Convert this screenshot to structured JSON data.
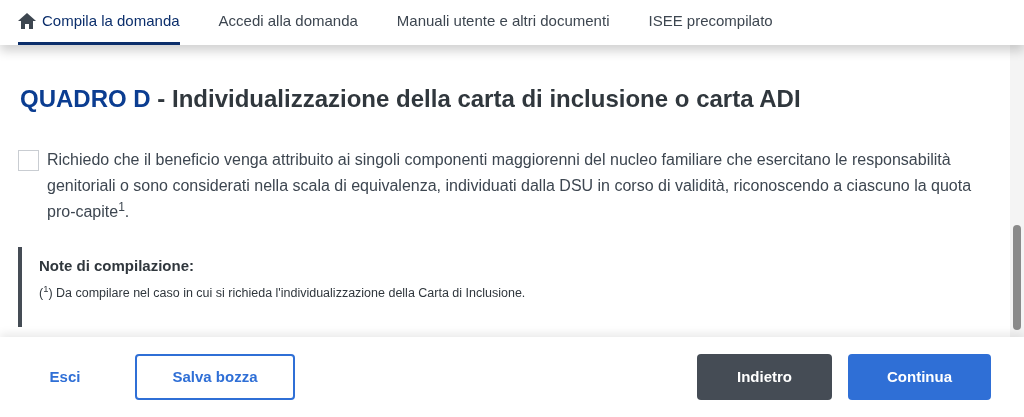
{
  "tabs": [
    {
      "label": "Compila la domanda",
      "selected": true
    },
    {
      "label": "Accedi alla domanda",
      "selected": false
    },
    {
      "label": "Manuali utente e altri documenti",
      "selected": false
    },
    {
      "label": "ISEE precompilato",
      "selected": false
    }
  ],
  "section": {
    "code": "QUADRO D",
    "separator": "-",
    "title": "Individualizzazione della carta di inclusione o carta ADI"
  },
  "option": {
    "checked": false,
    "text": "Richiedo che il beneficio venga attribuito ai singoli componenti maggiorenni del nucleo familiare che esercitano le responsabilità genitoriali o sono considerati nella scala di equivalenza, individuati dalla DSU in corso di validità, riconoscendo a ciascuno la quota pro-capite$^{1}$."
  },
  "notes": {
    "heading": "Note di compilazione:",
    "items": [
      "($^{1}$) Da compilare nel caso in cui si richieda l'individualizzazione della Carta di Inclusione."
    ]
  },
  "footer": {
    "buttons": [
      {
        "label": "Esci",
        "kind": "link"
      },
      {
        "label": "Salva bozza",
        "kind": "outline"
      },
      {
        "label": "Indietro",
        "kind": "dark"
      },
      {
        "label": "Continua",
        "kind": "primary"
      }
    ]
  }
}
